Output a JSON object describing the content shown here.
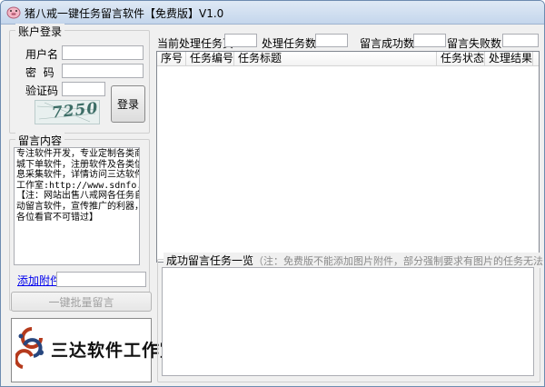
{
  "window": {
    "title": "猪八戒一键任务留言软件【免费版】V1.0"
  },
  "account": {
    "group_title": "账户登录",
    "username_label": "用户名",
    "password_label": "密  码",
    "captcha_label": "验证码",
    "captcha_text": "7250",
    "login_button": "登录"
  },
  "message": {
    "group_title": "留言内容",
    "content": "专注软件开发，专业定制各类商\n城下单软件，注册软件及各类信\n息采集软件，详情访问三达软件\n工作室:http://www.sdnfo.com\n【注：网站出售八戒网各任务自\n动留言软件，宣传推广的利器，\n各位看官不可错过】",
    "add_attachment_link": "添加附件",
    "batch_button": "一键批量留言"
  },
  "stats": {
    "current_page_label": "当前处理任务页:",
    "tasks_label": "处理任务数:",
    "success_label": "留言成功数:",
    "fail_label": "留言失败数:"
  },
  "task_table": {
    "columns": [
      "序号",
      "任务编号",
      "任务标题",
      "任务状态",
      "处理结果"
    ],
    "rows": []
  },
  "success_list": {
    "group_title": "成功留言任务一览",
    "note": "（注：免费版不能添加图片附件，部分强制要求有图片的任务无法留言）"
  },
  "logo": {
    "text": "三达软件工作室"
  }
}
